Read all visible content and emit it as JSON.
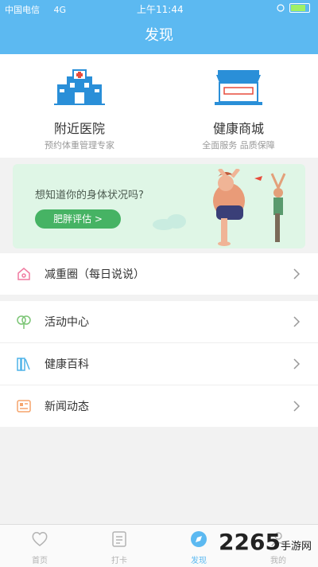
{
  "status_bar": {
    "carrier": "中国电信",
    "network": "4G",
    "time": "上午11:44"
  },
  "header": {
    "title": "发现"
  },
  "top_cards": [
    {
      "name": "附近医院",
      "sub": "预约体重管理专家"
    },
    {
      "name": "健康商城",
      "sub": "全面服务 品质保障"
    }
  ],
  "banner": {
    "question": "想知道你的身体状况吗?",
    "button": "肥胖评估 >"
  },
  "list": [
    {
      "label": "减重圈（每日说说）"
    },
    {
      "label": "活动中心"
    },
    {
      "label": "健康百科"
    },
    {
      "label": "新闻动态"
    }
  ],
  "tabbar": [
    {
      "label": "首页",
      "active": false
    },
    {
      "label": "打卡",
      "active": false
    },
    {
      "label": "发现",
      "active": true
    },
    {
      "label": "我的",
      "active": false
    }
  ],
  "watermark": {
    "text": "2265",
    "suffix": "手游网"
  },
  "colors": {
    "primary": "#5cb9f1",
    "green": "#46b364",
    "banner_bg": "#dff6e6"
  }
}
